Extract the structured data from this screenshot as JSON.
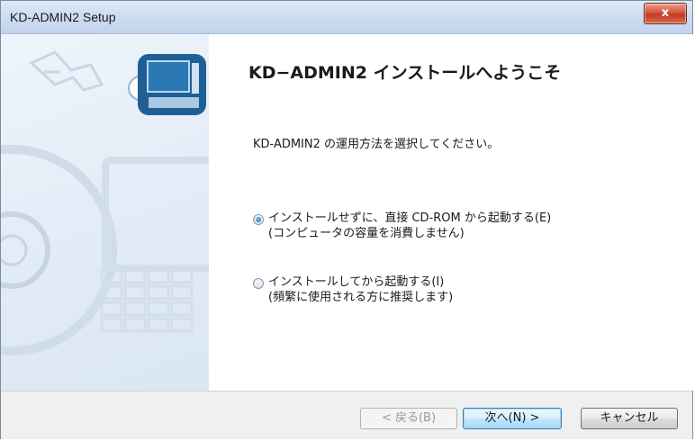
{
  "window": {
    "title": "KD-ADMIN2 Setup",
    "close_label": "x"
  },
  "main": {
    "heading": "KD−ADMIN2 インストールへようこそ",
    "prompt": "KD-ADMIN2 の運用方法を選択してください。",
    "options": [
      {
        "line1": "インストールせずに、直接 CD-ROM から起動する(E)",
        "line2": "(コンピュータの容量を消費しません)",
        "selected": true
      },
      {
        "line1": "インストールしてから起動する(I)",
        "line2": "(頻繁に使用される方に推奨します)",
        "selected": false
      }
    ]
  },
  "buttons": {
    "back": "< 戻る(B)",
    "next": "次へ(N) >",
    "cancel": "キャンセル"
  },
  "colors": {
    "titlebar": "#cddcf0",
    "close": "#c33b21",
    "panel": "#e1ebf6",
    "artwork": "#1f5f93"
  }
}
